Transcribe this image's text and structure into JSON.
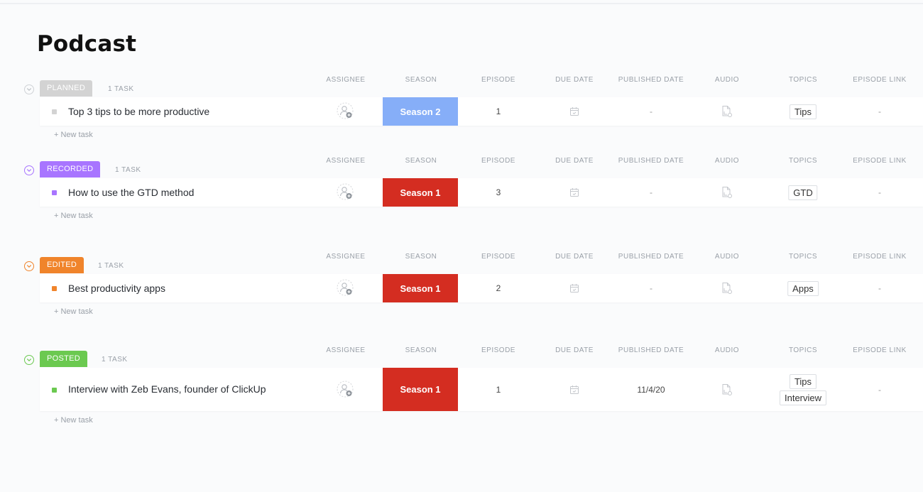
{
  "page": {
    "title": "Podcast"
  },
  "columns": [
    "ASSIGNEE",
    "SEASON",
    "EPISODE",
    "DUE DATE",
    "PUBLISHED DATE",
    "AUDIO",
    "TOPICS",
    "EPISODE LINK"
  ],
  "new_task_label": "+ New task",
  "groups": [
    {
      "status": "PLANNED",
      "color": "#d3d3d3",
      "count_label": "1 TASK",
      "tasks": [
        {
          "name": "Top 3 tips to be more productive",
          "season": "Season 2",
          "season_color": "#86aef8",
          "episode": "1",
          "due_date": "",
          "published_date": "-",
          "topics": [
            "Tips"
          ],
          "episode_link": "-"
        }
      ]
    },
    {
      "status": "RECORDED",
      "color": "#a875ff",
      "count_label": "1 TASK",
      "tasks": [
        {
          "name": "How to use the GTD method",
          "season": "Season 1",
          "season_color": "#d42d21",
          "episode": "3",
          "due_date": "",
          "published_date": "-",
          "topics": [
            "GTD"
          ],
          "episode_link": "-"
        }
      ]
    },
    {
      "status": "EDITED",
      "color": "#f0842b",
      "count_label": "1 TASK",
      "tasks": [
        {
          "name": "Best productivity apps",
          "season": "Season 1",
          "season_color": "#d42d21",
          "episode": "2",
          "due_date": "",
          "published_date": "-",
          "topics": [
            "Apps"
          ],
          "episode_link": "-"
        }
      ]
    },
    {
      "status": "POSTED",
      "color": "#6bc950",
      "count_label": "1 TASK",
      "tasks": [
        {
          "name": "Interview with Zeb Evans, founder of ClickUp",
          "season": "Season 1",
          "season_color": "#d42d21",
          "episode": "1",
          "due_date": "",
          "published_date": "11/4/20",
          "topics": [
            "Tips",
            "Interview"
          ],
          "episode_link": "-"
        }
      ]
    }
  ],
  "icons": {
    "collapse": "chevron-down-circle",
    "assignee": "add-assignee",
    "due_date": "calendar",
    "audio": "file-attachment"
  }
}
